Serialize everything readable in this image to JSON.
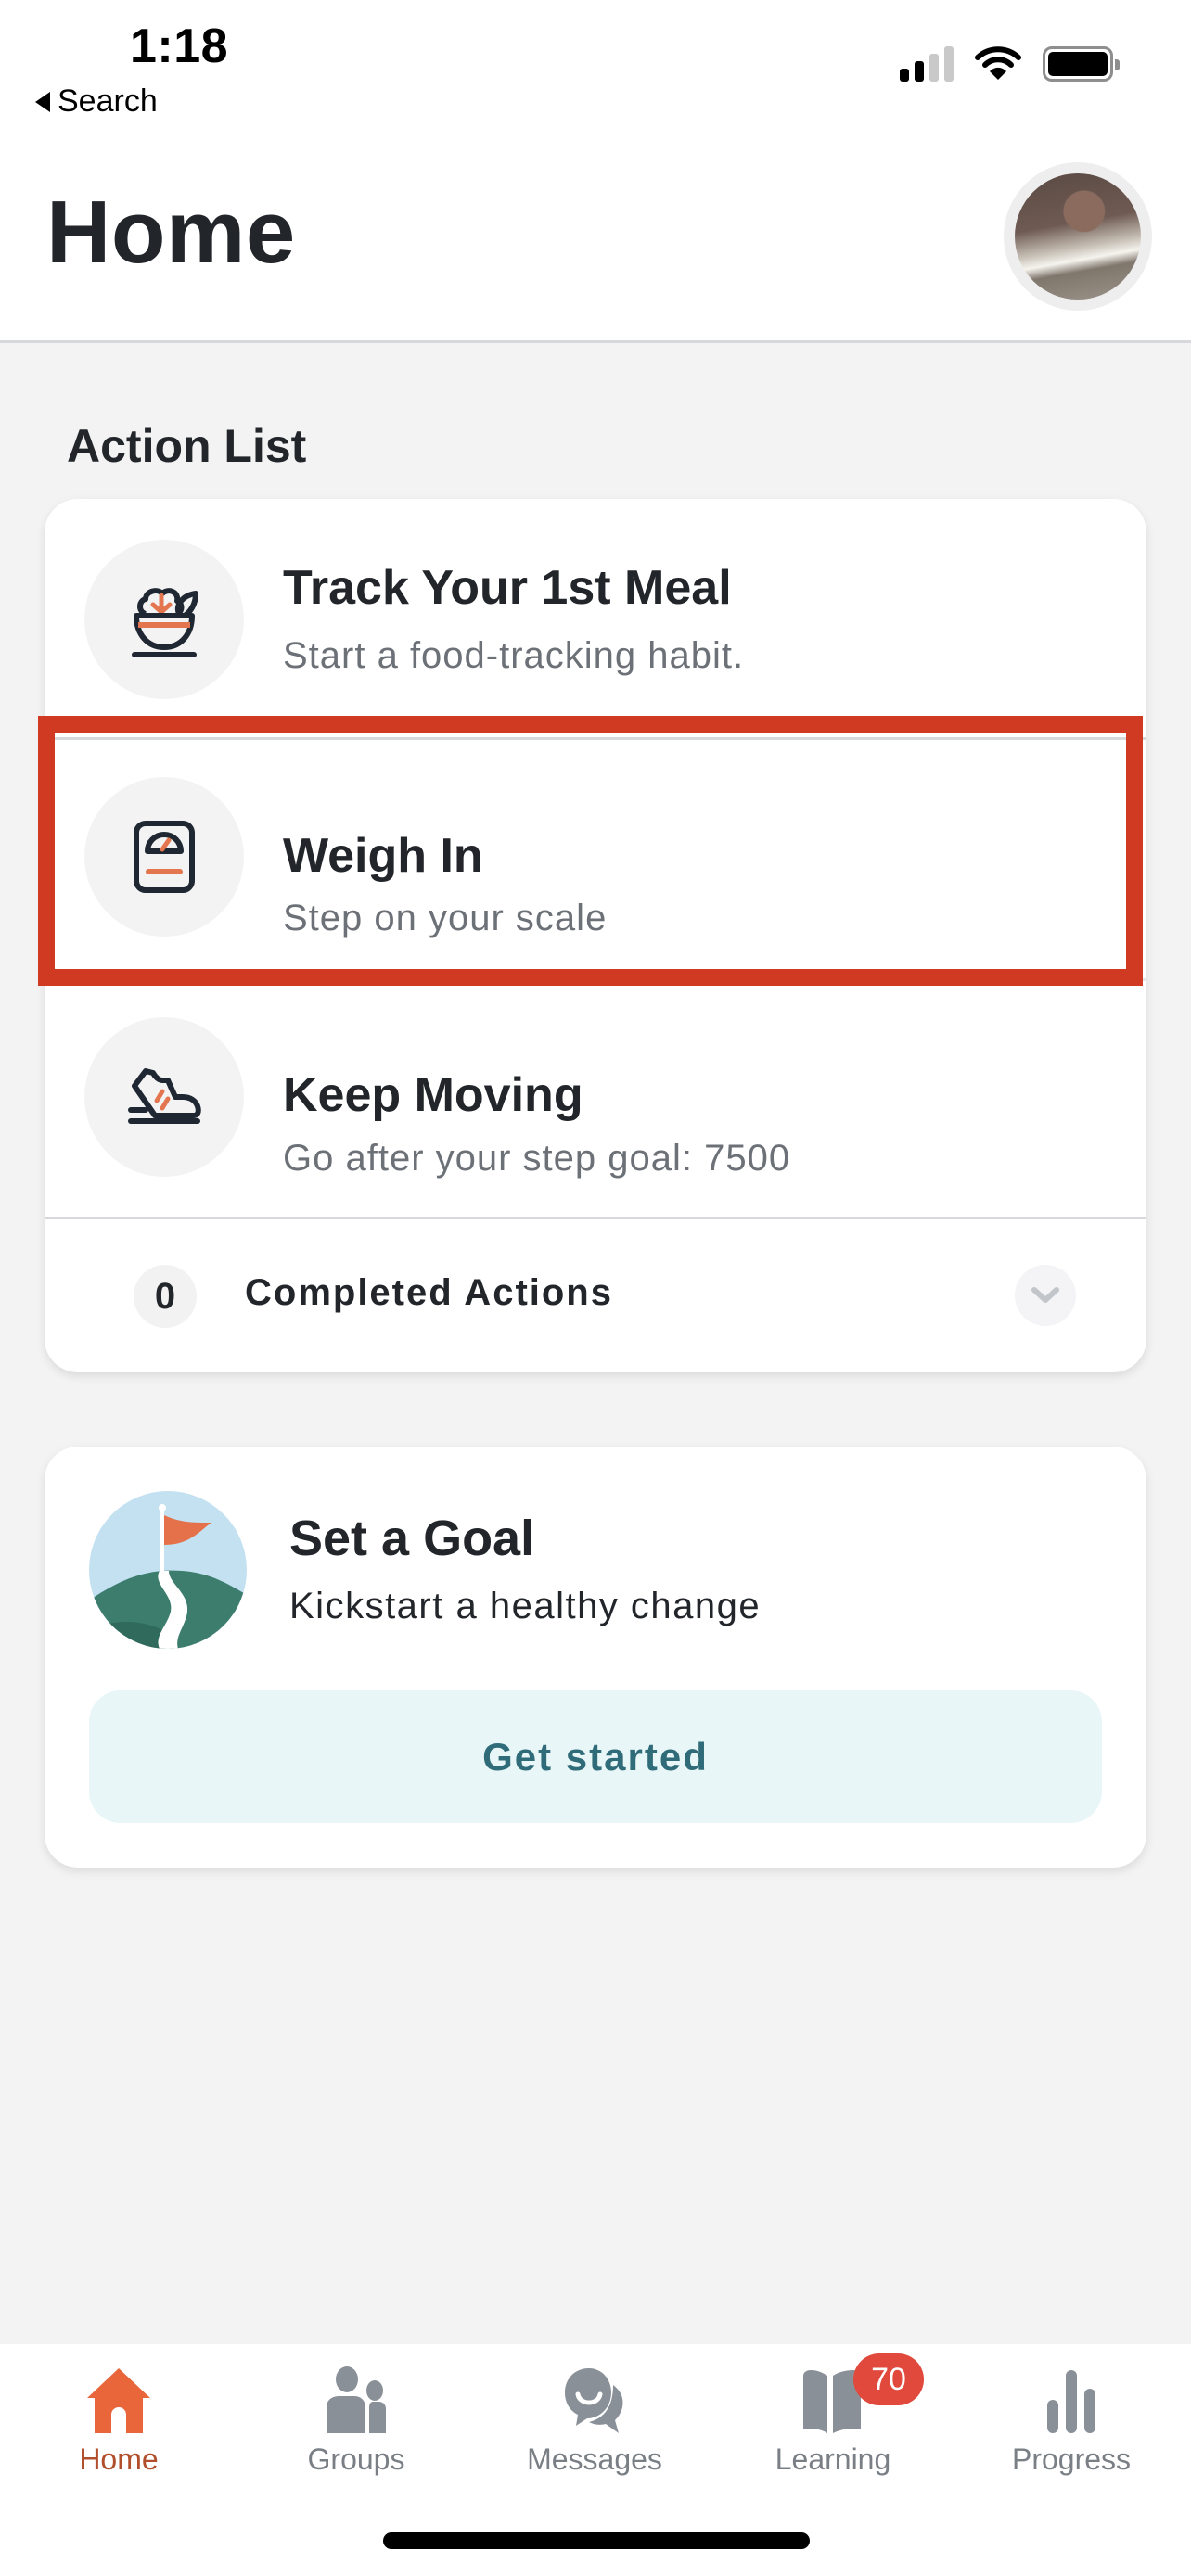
{
  "status_bar": {
    "time": "1:18",
    "back_label": "Search",
    "signal_bars_active": 2,
    "signal_bars_total": 4
  },
  "header": {
    "title": "Home",
    "avatar_alt": "Profile photo"
  },
  "action_list": {
    "heading": "Action List",
    "items": [
      {
        "icon": "salad-bowl-icon",
        "title": "Track Your 1st Meal",
        "subtitle": "Start a food-tracking habit."
      },
      {
        "icon": "scale-icon",
        "title": "Weigh In",
        "subtitle": "Step on your scale"
      },
      {
        "icon": "sneaker-icon",
        "title": "Keep Moving",
        "subtitle": "Go after your step goal: 7500"
      }
    ],
    "completed": {
      "count": "0",
      "label": "Completed Actions",
      "icon": "chevron-down-icon"
    }
  },
  "goal_card": {
    "icon": "flag-on-hill-icon",
    "title": "Set a Goal",
    "subtitle": "Kickstart a healthy change",
    "button_label": "Get started"
  },
  "tabbar": {
    "items": [
      {
        "label": "Home",
        "icon": "home-icon",
        "active": true
      },
      {
        "label": "Groups",
        "icon": "groups-icon",
        "active": false
      },
      {
        "label": "Messages",
        "icon": "messages-icon",
        "active": false
      },
      {
        "label": "Learning",
        "icon": "book-icon",
        "active": false,
        "badge": "70"
      },
      {
        "label": "Progress",
        "icon": "bar-chart-icon",
        "active": false
      }
    ]
  },
  "colors": {
    "accent": "#e8663a",
    "highlight": "#d13a22",
    "badge": "#e0493b",
    "button_bg": "#e8f6f8",
    "button_text": "#2f6b78",
    "icon_inactive": "#8a9098"
  }
}
